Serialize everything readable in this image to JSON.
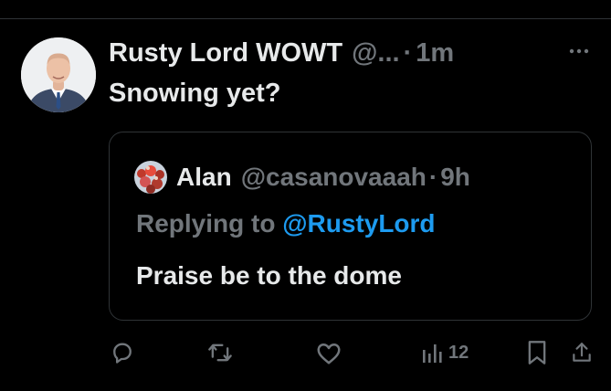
{
  "tweet": {
    "author_name": "Rusty Lord WOWT",
    "author_handle": "@...",
    "separator": "·",
    "time": "1m",
    "text": "Snowing yet?"
  },
  "quote": {
    "author_name": "Alan",
    "author_handle": "@casanovaaah",
    "separator": "·",
    "time": "9h",
    "replying_prefix": "Replying to",
    "replying_mention": "@RustyLord",
    "text": "Praise be to the dome"
  },
  "actions": {
    "views_count": "12"
  },
  "colors": {
    "background": "#000000",
    "text_primary": "#e7e9ea",
    "text_secondary": "#71767b",
    "link": "#1d9bf0",
    "border": "#2f3336"
  },
  "icons": {
    "reply": "reply-icon",
    "retweet": "retweet-icon",
    "like": "like-icon",
    "views": "views-icon",
    "bookmark": "bookmark-icon",
    "share": "share-icon",
    "more": "more-icon"
  }
}
